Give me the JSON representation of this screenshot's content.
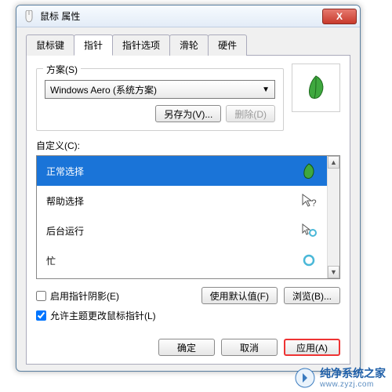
{
  "window": {
    "title": "鼠标 属性",
    "close": "X"
  },
  "tabs": {
    "t0": "鼠标键",
    "t1": "指针",
    "t2": "指针选项",
    "t3": "滑轮",
    "t4": "硬件"
  },
  "scheme": {
    "group_label": "方案(S)",
    "selected": "Windows Aero (系统方案)",
    "save_as": "另存为(V)...",
    "delete": "删除(D)"
  },
  "custom_label": "自定义(C):",
  "list": {
    "i0": "正常选择",
    "i1": "帮助选择",
    "i2": "后台运行",
    "i3": "忙"
  },
  "checks": {
    "shadow": "启用指针阴影(E)",
    "theme": "允许主题更改鼠标指针(L)"
  },
  "btns": {
    "defaults": "使用默认值(F)",
    "browse": "浏览(B)...",
    "ok": "确定",
    "cancel": "取消",
    "apply": "应用(A)"
  },
  "watermark": {
    "l1": "纯净系统之家",
    "l2": "www.zyzj.com"
  }
}
